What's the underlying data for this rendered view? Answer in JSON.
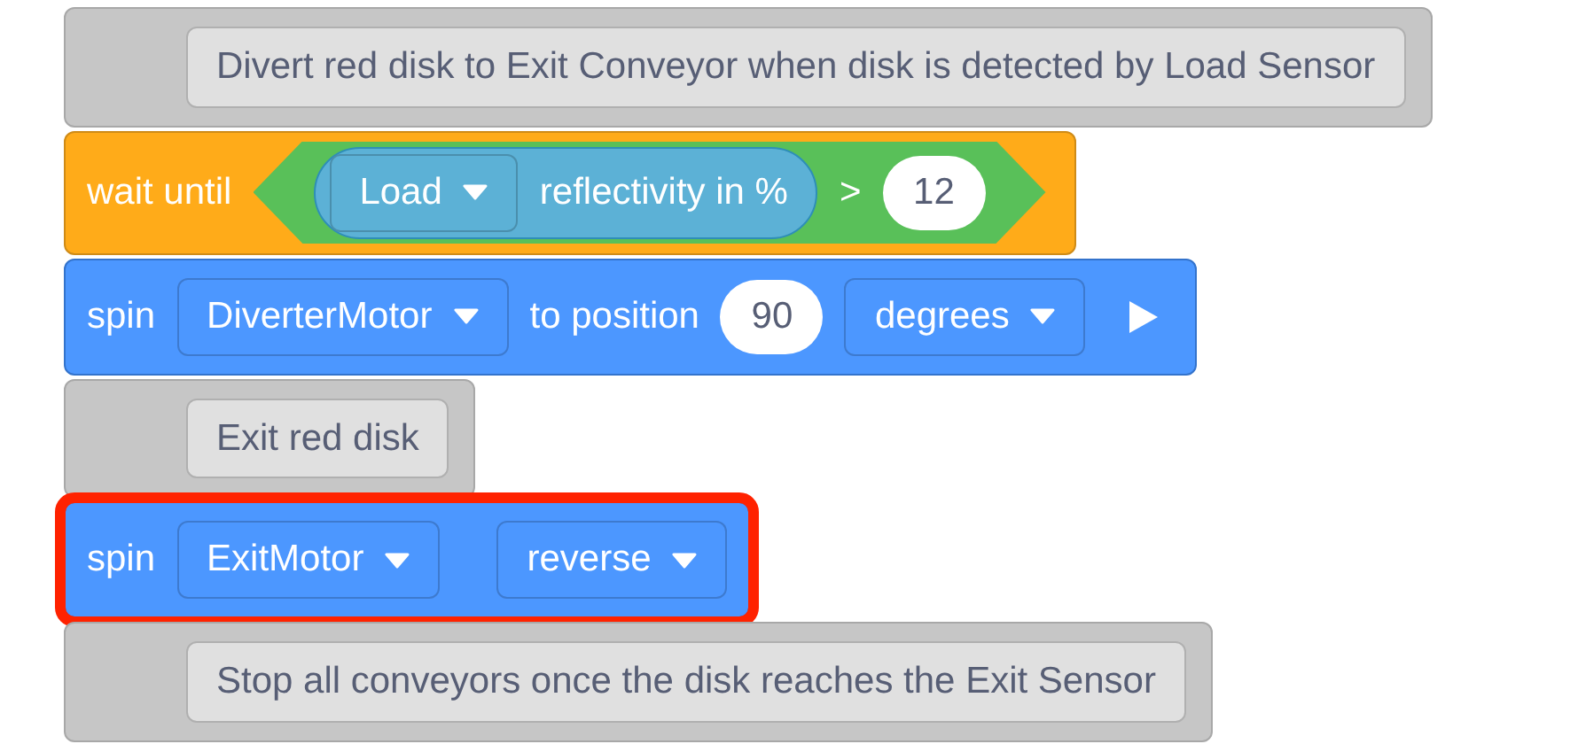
{
  "blocks": [
    {
      "kind": "comment",
      "text": "Divert red disk to Exit Conveyor when disk is detected by Load Sensor",
      "highlighted": false
    },
    {
      "kind": "wait_until",
      "label": "wait until",
      "sensor": "Load",
      "property": "reflectivity in %",
      "operator": ">",
      "value": "12",
      "highlighted": false
    },
    {
      "kind": "spin_to_position",
      "label": "spin",
      "motor": "DiverterMotor",
      "connector": "to position",
      "value": "90",
      "unit": "degrees",
      "highlighted": false
    },
    {
      "kind": "comment",
      "text": "Exit red disk",
      "highlighted": false
    },
    {
      "kind": "spin",
      "label": "spin",
      "motor": "ExitMotor",
      "direction": "reverse",
      "highlighted": true
    },
    {
      "kind": "comment",
      "text": "Stop all conveyors once the disk reaches the Exit Sensor",
      "highlighted": false
    }
  ]
}
